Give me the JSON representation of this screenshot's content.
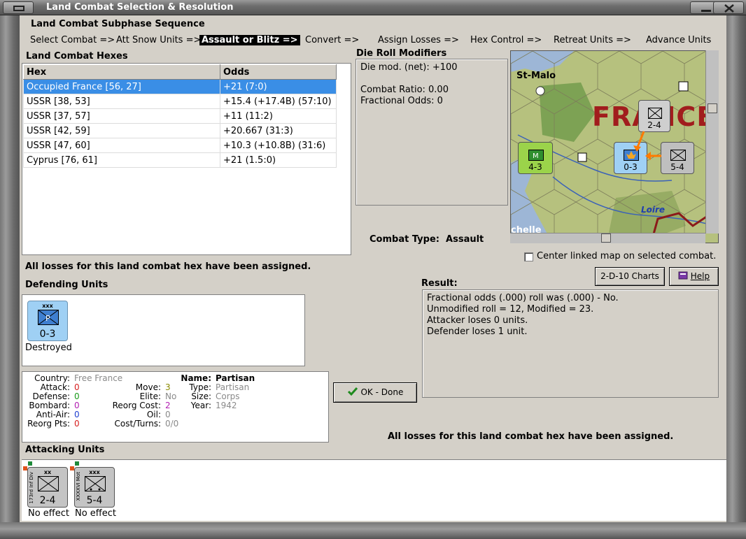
{
  "window": {
    "title": "Land Combat Selection & Resolution"
  },
  "subphase": {
    "title": "Land Combat Subphase Sequence",
    "steps": [
      "Select Combat =>",
      "Att Snow Units =>",
      "Assault or Blitz =>",
      "Convert =>",
      "Assign Losses =>",
      "Hex Control =>",
      "Retreat Units =>",
      "Advance Units"
    ],
    "active_index": 2
  },
  "hexes": {
    "title": "Land Combat Hexes",
    "columns": [
      "Hex",
      "Odds"
    ],
    "rows": [
      [
        "Occupied France [56, 27]",
        "+21 (7:0)"
      ],
      [
        "USSR [38, 53]",
        "+15.4 (+17.4B) (57:10)"
      ],
      [
        "USSR [37, 57]",
        "+11 (11:2)"
      ],
      [
        "USSR [42, 59]",
        "+20.667 (31:3)"
      ],
      [
        "USSR [47, 60]",
        "+10.3 (+10.8B) (31:6)"
      ],
      [
        "Cyprus [76, 61]",
        "+21 (1.5:0)"
      ]
    ],
    "selected_index": 0
  },
  "drm": {
    "title": "Die Roll Modifiers",
    "lines": [
      "Die mod. (net): +100",
      "",
      "Combat Ratio: 0.00",
      "Fractional Odds: 0"
    ]
  },
  "combat_type": {
    "label": "Combat Type:",
    "value": "Assault"
  },
  "map": {
    "labels": {
      "city": "St-Malo",
      "country": "FRANCE",
      "river": "Loire",
      "partial": "chelle"
    },
    "units": {
      "attacker_top": "2-4",
      "attacker_right": "5-4",
      "attacker_left": "4-3",
      "defender": "0-3"
    },
    "colors": {
      "sea": "#9db6d6",
      "land": "#b6c17e",
      "forest": "#6f9a4a",
      "country_text": "#a11d1d"
    }
  },
  "center_map": {
    "label": "Center linked map on selected combat.",
    "checked": false
  },
  "buttons": {
    "charts": "2-D-10 Charts",
    "help": "Help",
    "ok": "OK - Done"
  },
  "messages": {
    "losses_assigned": "All losses for this land combat hex have been assigned.",
    "losses_assigned_2": "All losses for this land combat hex have been assigned."
  },
  "result": {
    "title": "Result:",
    "lines": [
      "Fractional odds (.000) roll was (.000)  - No.",
      "Unmodified roll = 12, Modified = 23.",
      "Attacker loses 0 units.",
      "Defender loses 1 unit."
    ]
  },
  "defending": {
    "title": "Defending Units",
    "units": [
      {
        "size": "xxx",
        "strength": "0-3",
        "type_letter": "P",
        "status": "Destroyed"
      }
    ]
  },
  "unit_info": {
    "country_label": "Country:",
    "country": "Free France",
    "attack_label": "Attack:",
    "attack": "0",
    "defense_label": "Defense:",
    "defense": "0",
    "bombard_label": "Bombard:",
    "bombard": "0",
    "antiair_label": "Anti-Air:",
    "antiair": "0",
    "reorgpts_label": "Reorg Pts:",
    "reorgpts": "0",
    "move_label": "Move:",
    "move": "3",
    "elite_label": "Elite:",
    "elite": "No",
    "reorgcost_label": "Reorg Cost:",
    "reorgcost": "2",
    "oil_label": "Oil:",
    "oil": "0",
    "costturns_label": "Cost/Turns:",
    "costturns": "0/0",
    "name_label": "Name:",
    "name": "Partisan",
    "type_label": "Type:",
    "type": "Partisan",
    "size_label": "Size:",
    "size": "Corps",
    "year_label": "Year:",
    "year": "1942"
  },
  "attacking": {
    "title": "Attacking Units",
    "units": [
      {
        "size": "xx",
        "strength": "2-4",
        "name": "173rd Inf Div",
        "status": "No effect"
      },
      {
        "size": "xxx",
        "strength": "5-4",
        "name": "XXXXVI Mot",
        "status": "No effect"
      }
    ]
  }
}
